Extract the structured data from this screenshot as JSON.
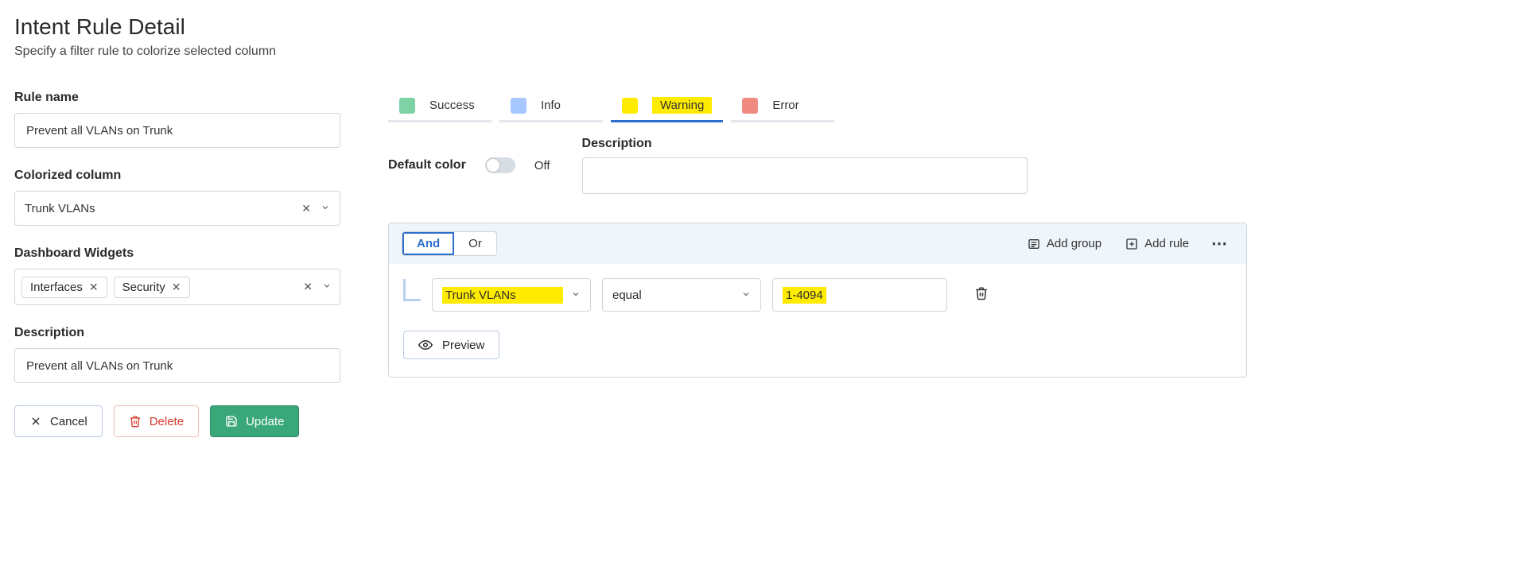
{
  "header": {
    "title": "Intent Rule Detail",
    "subtitle": "Specify a filter rule to colorize selected column"
  },
  "left": {
    "rule_name_label": "Rule name",
    "rule_name_value": "Prevent all VLANs on Trunk",
    "colorized_column_label": "Colorized column",
    "colorized_column_value": "Trunk VLANs",
    "widgets_label": "Dashboard Widgets",
    "widget_tags": [
      "Interfaces",
      "Security"
    ],
    "description_label": "Description",
    "description_value": "Prevent all VLANs on Trunk",
    "cancel_label": "Cancel",
    "delete_label": "Delete",
    "update_label": "Update"
  },
  "right": {
    "tabs": {
      "success": {
        "label": "Success",
        "color": "#7fd1a6"
      },
      "info": {
        "label": "Info",
        "color": "#a6c7ff"
      },
      "warning": {
        "label": "Warning",
        "color": "#ffeb00"
      },
      "error": {
        "label": "Error",
        "color": "#ef8a80"
      }
    },
    "default_color_label": "Default color",
    "default_color_state": "Off",
    "description_label": "Description",
    "description_value": "",
    "andor": {
      "and": "And",
      "or": "Or"
    },
    "add_group": "Add group",
    "add_rule": "Add rule",
    "rule": {
      "field": "Trunk VLANs",
      "operator": "equal",
      "value": "1-4094"
    },
    "preview": "Preview"
  }
}
